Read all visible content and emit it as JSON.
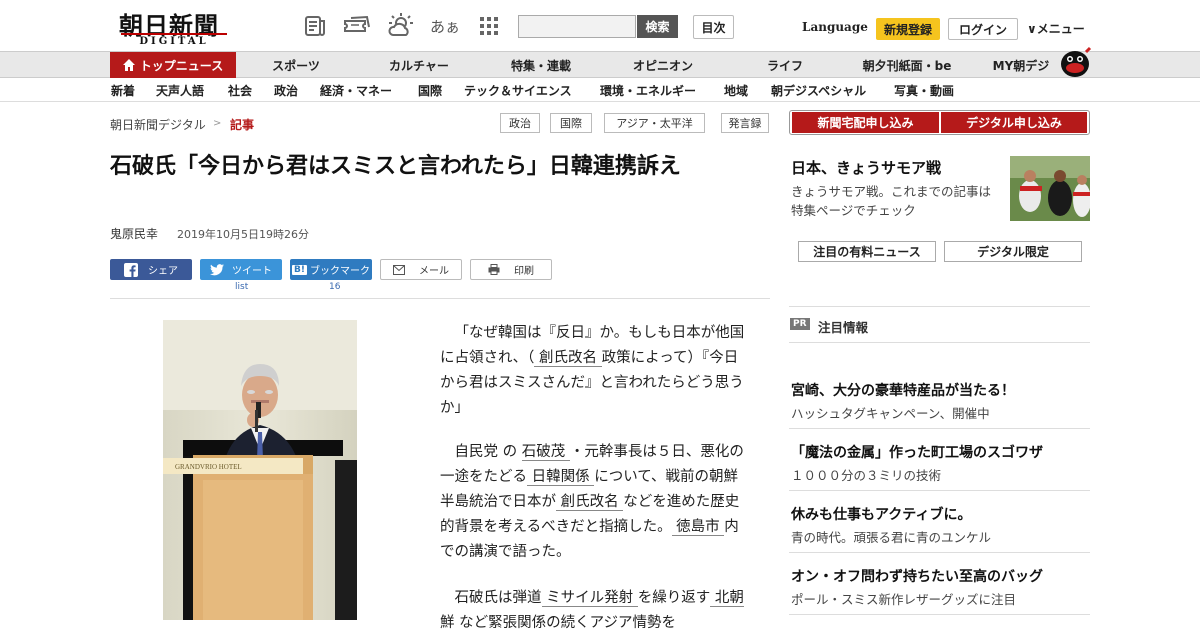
{
  "header": {
    "logo_main": "朝日新聞",
    "logo_sub": "DIGITAL",
    "icons": [
      "newspaper-icon",
      "coupon-icon",
      "weather-icon",
      "font-size-icon",
      "apps-grid-icon"
    ],
    "font_icon_text": "あぁ",
    "search_placeholder": "",
    "search_label": "検索",
    "index_label": "目次",
    "language_label": "Language",
    "register_label": "新規登録",
    "login_label": "ログイン",
    "menu_label": "∨メニュー"
  },
  "nav_main": [
    {
      "label": "トップニュース",
      "active": true
    },
    {
      "label": "スポーツ"
    },
    {
      "label": "カルチャー"
    },
    {
      "label": "特集・連載"
    },
    {
      "label": "オピニオン"
    },
    {
      "label": "ライフ"
    },
    {
      "label": "朝夕刊紙面・be"
    },
    {
      "label": "MY朝デジ"
    }
  ],
  "nav_sub": [
    "新着",
    "天声人語",
    "社会",
    "政治",
    "経済・マネー",
    "国際",
    "テック＆サイエンス",
    "環境・エネルギー",
    "地域",
    "朝デジスペシャル",
    "写真・動画"
  ],
  "breadcrumb": {
    "home": "朝日新聞デジタル",
    "sep": ">",
    "current": "記事"
  },
  "tags": [
    "政治",
    "国際",
    "アジア・太平洋",
    "発言録"
  ],
  "article": {
    "title": "石破氏「今日から君はスミスと言われたら」日韓連携訴え",
    "author": "鬼原民幸",
    "date": "2019年10月5日19時26分",
    "share": {
      "facebook": "シェア",
      "twitter": "ツイート",
      "twitter_count": "list",
      "hatena": "ブックマーク",
      "hatena_count": "16",
      "mail": "メール",
      "print": "印刷"
    },
    "paragraphs": [
      [
        "「なぜ韓国は『反日』か。もしも日本が他国に占領され、（",
        {
          "u": "創氏改名"
        },
        "政策によって）『今日から君はスミスさんだ』と言われたらどう思うか」"
      ],
      [
        "自民党",
        {
          "sp": "の"
        },
        {
          "u": "石破茂"
        },
        "・元幹事長は５日、悪化の一途をたどる",
        {
          "u": "日韓関係"
        },
        "について、戦前の朝鮮半島統治で日本が",
        {
          "u": "創氏改名"
        },
        "などを進めた歴史的背景を考えるべきだと指摘した。",
        {
          "u": "徳島市"
        },
        "内での講演で語った。"
      ],
      [
        "石破氏は弾道",
        {
          "u": "ミサイル発射"
        },
        "を繰り返す",
        {
          "u": "北朝鮮"
        },
        "など緊張関係の続くアジア情勢を"
      ]
    ]
  },
  "sidebar": {
    "btn_newspaper": "新聞宅配申し込み",
    "btn_digital": "デジタル申し込み",
    "feature_title": "日本、きょうサモア戦",
    "feature_desc": "きょうサモア戦。これまでの記事は特集ページでチェック",
    "btn_paid": "注目の有料ニュース",
    "btn_limited": "デジタル限定",
    "pr_badge": "PR",
    "pr_title": "注目情報",
    "items": [
      {
        "title": "宮崎、大分の豪華特産品が当たる！",
        "desc": "ハッシュタグキャンペーン、開催中"
      },
      {
        "title": "「魔法の金属」作った町工場のスゴワザ",
        "desc": "１０００分の３ミリの技術"
      },
      {
        "title": "休みも仕事もアクティブに。",
        "desc": "青の時代。頑張る君に青のユンケル"
      },
      {
        "title": "オン・オフ問わず持ちたい至高のバッグ",
        "desc": "ポール・スミス新作レザーグッズに注目"
      }
    ]
  },
  "colors": {
    "brand_red": "#b51a1a",
    "register_yellow": "#f5c41e",
    "twitter_blue": "#3b94d9",
    "facebook_blue": "#3b5998",
    "hatena_blue": "#2f7bc0"
  }
}
